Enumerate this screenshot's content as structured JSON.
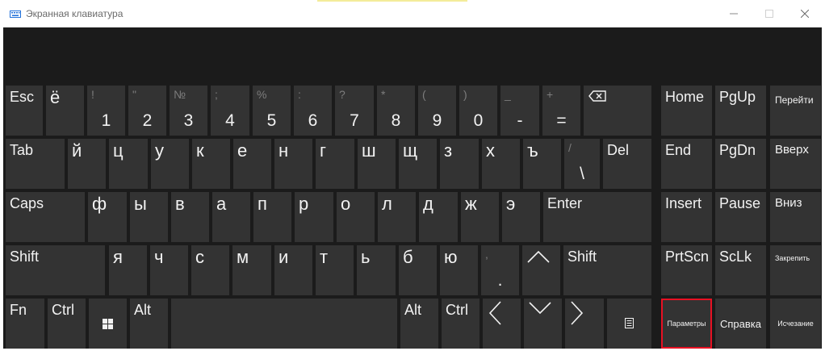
{
  "window": {
    "title": "Экранная клавиатура",
    "icon": "keyboard-icon",
    "controls": [
      "minimize-icon",
      "maximize-icon",
      "close-icon"
    ]
  },
  "row1": {
    "esc": "Esc",
    "yo": "ё",
    "nums": [
      {
        "sym": "!",
        "digit": "1"
      },
      {
        "sym": "\"",
        "digit": "2"
      },
      {
        "sym": "№",
        "digit": "3"
      },
      {
        "sym": ";",
        "digit": "4"
      },
      {
        "sym": "%",
        "digit": "5"
      },
      {
        "sym": ":",
        "digit": "6"
      },
      {
        "sym": "?",
        "digit": "7"
      },
      {
        "sym": "*",
        "digit": "8"
      },
      {
        "sym": "(",
        "digit": "9"
      },
      {
        "sym": ")",
        "digit": "0"
      },
      {
        "sym": "_",
        "digit": "-"
      },
      {
        "sym": "+",
        "digit": "="
      }
    ],
    "backspace_icon": "backspace-icon"
  },
  "row2": {
    "tab": "Tab",
    "letters": [
      "й",
      "ц",
      "у",
      "к",
      "е",
      "н",
      "г",
      "ш",
      "щ",
      "з",
      "х",
      "ъ"
    ],
    "slash_sym": "/",
    "slash": "\\",
    "del": "Del"
  },
  "row3": {
    "caps": "Caps",
    "letters": [
      "ф",
      "ы",
      "в",
      "а",
      "п",
      "р",
      "о",
      "л",
      "д",
      "ж",
      "э"
    ],
    "enter": "Enter"
  },
  "row4": {
    "shift": "Shift",
    "letters": [
      "я",
      "ч",
      "с",
      "м",
      "и",
      "т",
      "ь",
      "б",
      "ю"
    ],
    "comma": ",",
    "period": ".",
    "up_icon": "arrow-up-icon",
    "shift_right": "Shift"
  },
  "row5": {
    "fn": "Fn",
    "ctrl": "Ctrl",
    "win_icon": "windows-icon",
    "alt": "Alt",
    "alt_right": "Alt",
    "ctrl_right": "Ctrl",
    "left_icon": "arrow-left-icon",
    "down_icon": "arrow-down-icon",
    "right_icon": "arrow-right-icon",
    "menu_icon": "context-menu-icon"
  },
  "nav": {
    "home": "Home",
    "pgup": "PgUp",
    "end": "End",
    "pgdn": "PgDn",
    "insert": "Insert",
    "pause": "Pause",
    "prtscn": "PrtScn",
    "sclk": "ScLk"
  },
  "side": {
    "goto": "Перейти",
    "up": "Вверх",
    "down": "Вниз",
    "pin": "Закрепить",
    "fade": "Исчезание"
  },
  "options": {
    "params": "Параметры",
    "help": "Справка"
  },
  "colors": {
    "keyboard_bg": "#1b1b1b",
    "key": "#333333",
    "text": "#f2f2f2",
    "secondary_text": "#7d7d7d",
    "highlight": "#e81123",
    "title_accent": "#f4ec9a"
  }
}
